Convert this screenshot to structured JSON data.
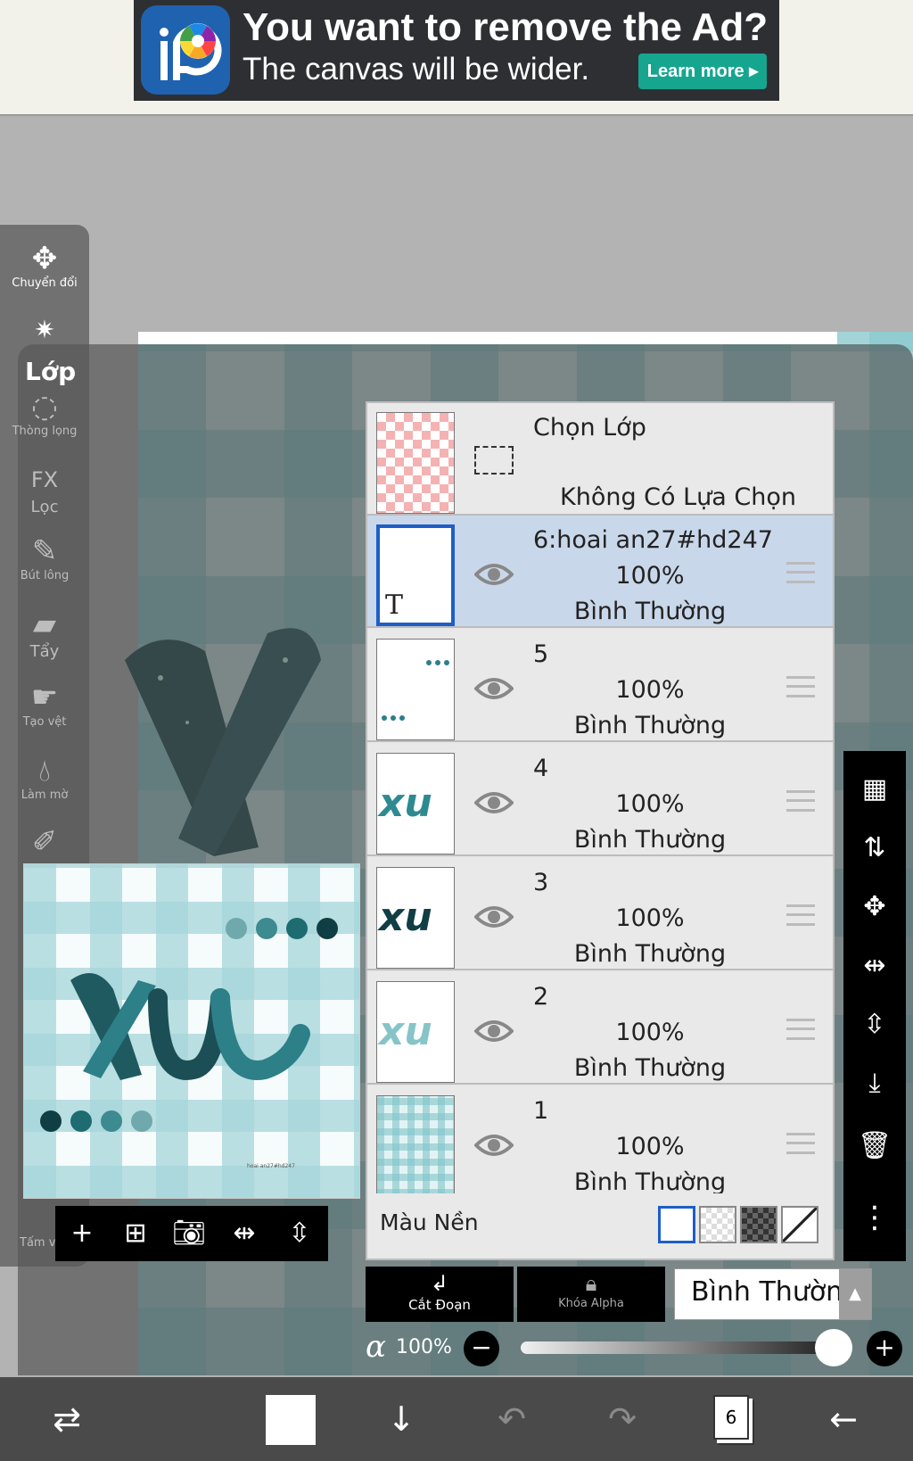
{
  "ad": {
    "title": "You want to remove the Ad?",
    "subtitle": "The canvas will be wider.",
    "learn_more": "Learn more ▸"
  },
  "tools": {
    "transform": "Chuyển đổi",
    "layer_title": "Lớp",
    "lasso": "Thòng lọng",
    "fx_icon": "FX",
    "filter": "Lọc",
    "brush": "Bút lông",
    "eraser": "Tẩy",
    "smudge": "Tạo vệt",
    "blur": "Làm mờ",
    "canvas": "Tấm v"
  },
  "layers_panel": {
    "selection_layer": {
      "title": "Chọn Lớp",
      "status": "Không Có Lựa Chọn"
    },
    "layers": [
      {
        "name": "6:hoai an27#hd247",
        "opacity": "100%",
        "mode": "Bình Thường",
        "selected": true,
        "thumb_label": "T"
      },
      {
        "name": "5",
        "opacity": "100%",
        "mode": "Bình Thường",
        "selected": false,
        "thumb_label": ""
      },
      {
        "name": "4",
        "opacity": "100%",
        "mode": "Bình Thường",
        "selected": false,
        "thumb_label": "xu"
      },
      {
        "name": "3",
        "opacity": "100%",
        "mode": "Bình Thường",
        "selected": false,
        "thumb_label": "xu"
      },
      {
        "name": "2",
        "opacity": "100%",
        "mode": "Bình Thường",
        "selected": false,
        "thumb_label": "xu"
      },
      {
        "name": "1",
        "opacity": "100%",
        "mode": "Bình Thường",
        "selected": false,
        "thumb_label": ""
      }
    ],
    "background_label": "Màu Nền"
  },
  "actions": {
    "clipping": "Cắt Đoạn",
    "alpha_lock": "Khóa Alpha",
    "blend_mode": "Bình Thường"
  },
  "opacity": {
    "symbol": "α",
    "value": "100%",
    "level": 1.0
  },
  "bottom": {
    "layer_count": "6"
  },
  "colors": {
    "teal_dark": "#0f3e44",
    "teal_mid": "#2d7f88",
    "teal_light": "#86c4c8",
    "selection_blue": "#1d5ec8",
    "selected_row": "#c9d7ea"
  }
}
